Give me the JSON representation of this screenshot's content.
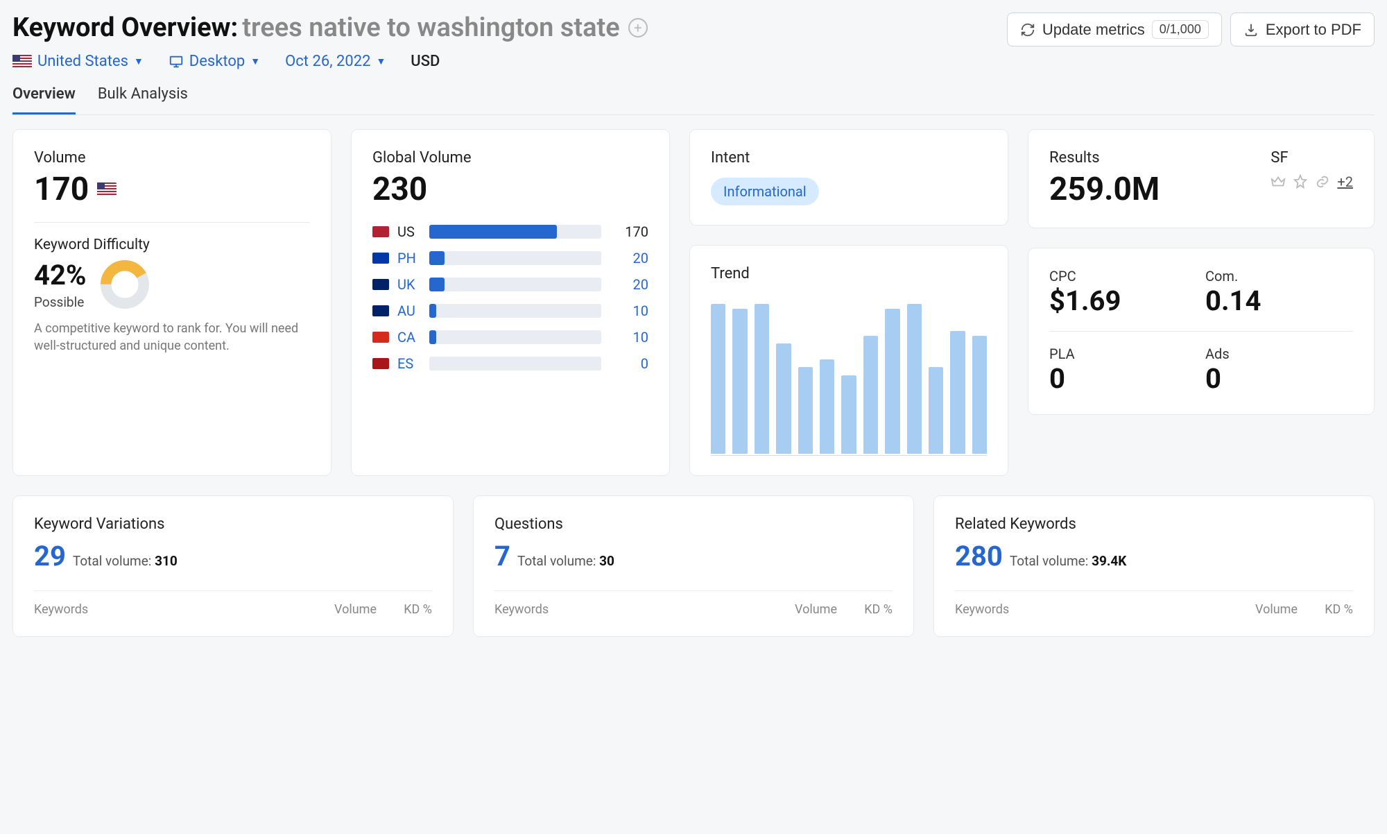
{
  "header": {
    "title_prefix": "Keyword Overview:",
    "keyword": "trees native to washington state",
    "update_label": "Update metrics",
    "update_counter": "0/1,000",
    "export_label": "Export to PDF"
  },
  "filters": {
    "country": "United States",
    "device": "Desktop",
    "date": "Oct 26, 2022",
    "currency": "USD"
  },
  "tabs": {
    "overview": "Overview",
    "bulk": "Bulk Analysis"
  },
  "volume_card": {
    "title": "Volume",
    "value": "170",
    "kd_title": "Keyword Difficulty",
    "kd_value": "42%",
    "kd_label": "Possible",
    "kd_desc": "A competitive keyword to rank for. You will need well-structured and unique content."
  },
  "global_volume": {
    "title": "Global Volume",
    "total": "230",
    "rows": [
      {
        "cc": "US",
        "value": 170,
        "pct": 74,
        "flag": "#b22234"
      },
      {
        "cc": "PH",
        "value": 20,
        "pct": 9,
        "flag": "#0038a8"
      },
      {
        "cc": "UK",
        "value": 20,
        "pct": 9,
        "flag": "#012169"
      },
      {
        "cc": "AU",
        "value": 10,
        "pct": 4,
        "flag": "#012169"
      },
      {
        "cc": "CA",
        "value": 10,
        "pct": 4,
        "flag": "#d52b1e"
      },
      {
        "cc": "ES",
        "value": 0,
        "pct": 0,
        "flag": "#aa151b"
      }
    ]
  },
  "intent": {
    "title": "Intent",
    "badge": "Informational"
  },
  "results": {
    "title": "Results",
    "value": "259.0M",
    "sf_title": "SF",
    "sf_extra": "+2"
  },
  "cpc": {
    "cpc_label": "CPC",
    "cpc_value": "$1.69",
    "com_label": "Com.",
    "com_value": "0.14",
    "pla_label": "PLA",
    "pla_value": "0",
    "ads_label": "Ads",
    "ads_value": "0"
  },
  "trend": {
    "title": "Trend"
  },
  "chart_data": {
    "type": "bar",
    "title": "Trend",
    "categories": [
      "1",
      "2",
      "3",
      "4",
      "5",
      "6",
      "7",
      "8",
      "9",
      "10",
      "11",
      "12",
      "13"
    ],
    "values": [
      95,
      92,
      95,
      70,
      55,
      60,
      50,
      75,
      92,
      95,
      55,
      78,
      75
    ],
    "ylim": [
      0,
      100
    ]
  },
  "bottom": {
    "variations": {
      "title": "Keyword Variations",
      "count": "29",
      "totvol_label": "Total volume:",
      "totvol_value": "310",
      "cols": {
        "kw": "Keywords",
        "vol": "Volume",
        "kd": "KD %"
      }
    },
    "questions": {
      "title": "Questions",
      "count": "7",
      "totvol_label": "Total volume:",
      "totvol_value": "30",
      "cols": {
        "kw": "Keywords",
        "vol": "Volume",
        "kd": "KD %"
      }
    },
    "related": {
      "title": "Related Keywords",
      "count": "280",
      "totvol_label": "Total volume:",
      "totvol_value": "39.4K",
      "cols": {
        "kw": "Keywords",
        "vol": "Volume",
        "kd": "KD %"
      }
    }
  }
}
